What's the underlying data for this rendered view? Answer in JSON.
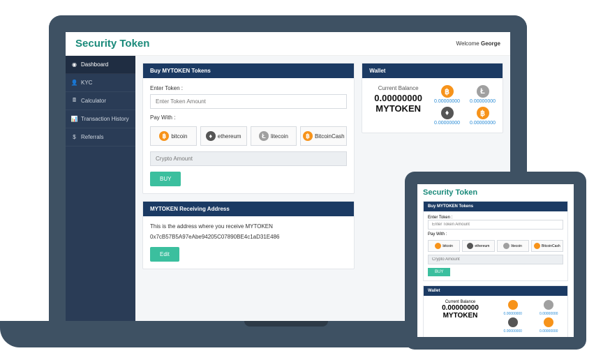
{
  "brand": "Security Token",
  "welcome_prefix": "Welcome",
  "welcome_user": "George",
  "sidebar": {
    "items": [
      {
        "label": "Dashboard",
        "icon": "◉"
      },
      {
        "label": "KYC",
        "icon": "👤"
      },
      {
        "label": "Calculator",
        "icon": "🖩"
      },
      {
        "label": "Transaction History",
        "icon": "📊"
      },
      {
        "label": "Referrals",
        "icon": "$"
      }
    ]
  },
  "buy": {
    "header": "Buy MYTOKEN Tokens",
    "enter_label": "Enter Token :",
    "enter_placeholder": "Enter Token Amount",
    "paywith_label": "Pay With :",
    "methods": {
      "btc": "bitcoin",
      "eth": "ethereum",
      "ltc": "litecoin",
      "bch": "BitcoinCash"
    },
    "crypto_amount_placeholder": "Crypto Amount",
    "buy_label": "BUY"
  },
  "recv": {
    "header": "MYTOKEN Receiving Address",
    "desc": "This is the address where you receive MYTOKEN",
    "address": "0x7cB57B5A97eAbe94205C07890BE4c1aD31E486",
    "edit_label": "Edit"
  },
  "wallet": {
    "header": "Wallet",
    "balance_label": "Current Balance",
    "balance_amount": "0.00000000",
    "balance_token": "MYTOKEN",
    "coins": [
      {
        "name": "btc",
        "value": "0.00000000"
      },
      {
        "name": "ltc",
        "value": "0.00000000"
      },
      {
        "name": "eth",
        "value": "0.00000000"
      },
      {
        "name": "bch",
        "value": "0.00000000"
      }
    ]
  }
}
